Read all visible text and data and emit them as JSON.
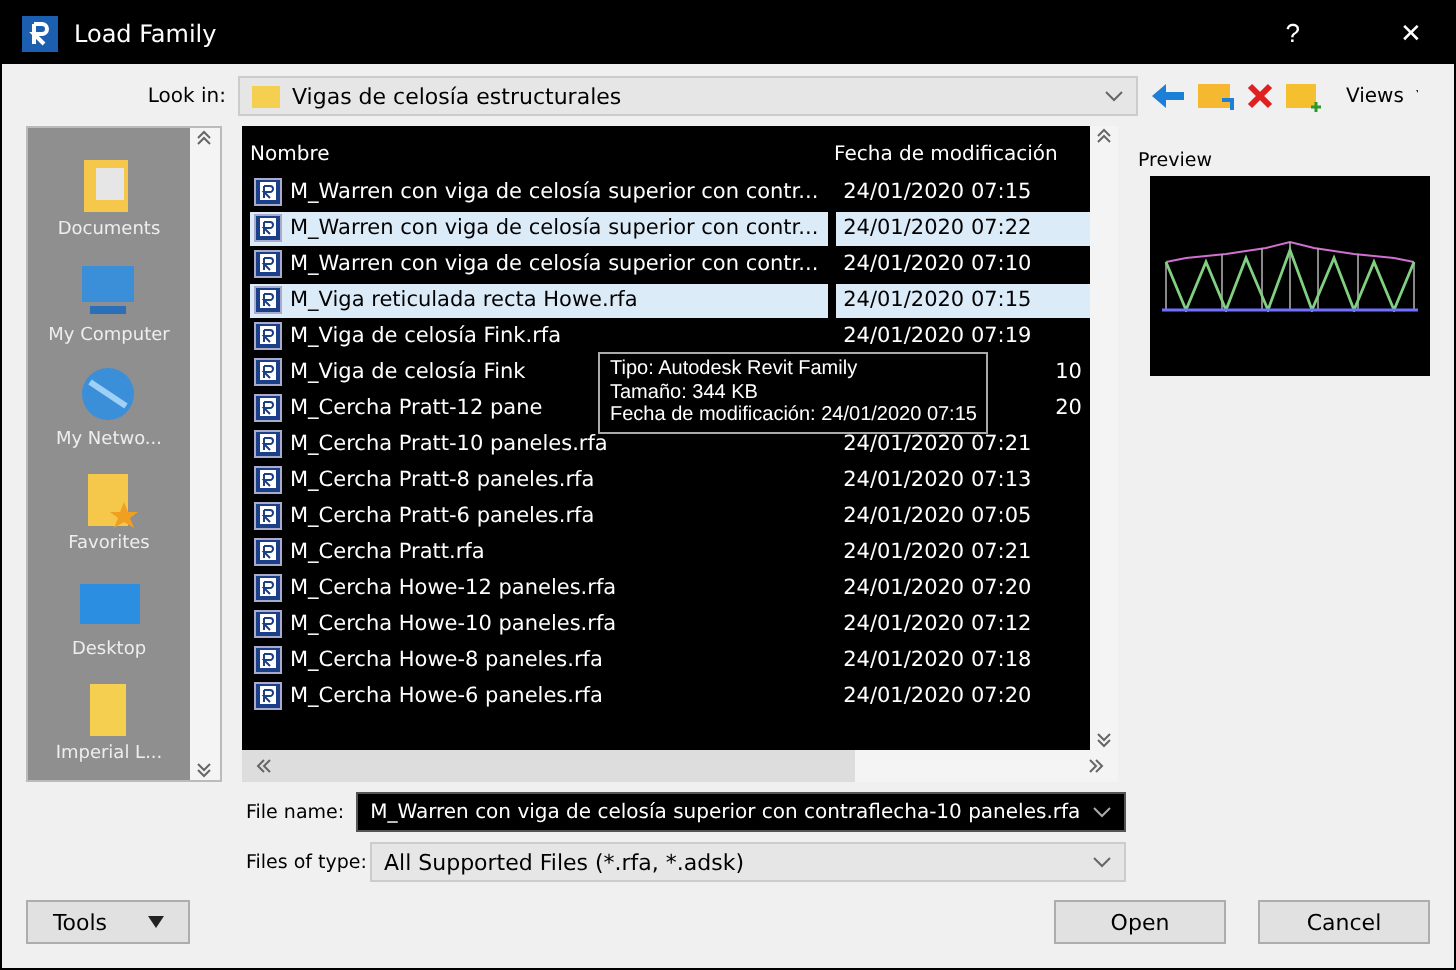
{
  "window": {
    "title": "Load Family",
    "help": "?",
    "close": "✕"
  },
  "look_in": {
    "label": "Look in:",
    "value": "Vigas de celosía estructurales"
  },
  "toolbar": {
    "views": "Views"
  },
  "places": [
    {
      "label": "Documents",
      "kind": "documents"
    },
    {
      "label": "My Computer",
      "kind": "computer"
    },
    {
      "label": "My Netwo...",
      "kind": "network"
    },
    {
      "label": "Favorites",
      "kind": "favorites"
    },
    {
      "label": "Desktop",
      "kind": "desktop"
    },
    {
      "label": "Imperial L...",
      "kind": "folder"
    }
  ],
  "columns": [
    "Nombre",
    "Fecha de modificación"
  ],
  "files": [
    {
      "name": "M_Warren con viga de celosía superior con contr...",
      "date": "24/01/2020 07:15",
      "selected": false,
      "covered": false
    },
    {
      "name": "M_Warren con viga de celosía superior con contr...",
      "date": "24/01/2020 07:22",
      "selected": true,
      "covered": false
    },
    {
      "name": "M_Warren con viga de celosía superior con contr...",
      "date": "24/01/2020 07:10",
      "selected": false,
      "covered": false
    },
    {
      "name": "M_Viga reticulada recta Howe.rfa",
      "date": "24/01/2020 07:15",
      "selected": true,
      "covered": false
    },
    {
      "name": "M_Viga de celosía Fink.rfa",
      "date": "24/01/2020 07:19",
      "selected": false,
      "covered": false
    },
    {
      "name": "M_Viga de celosía Fink",
      "date": "10",
      "selected": false,
      "covered": true
    },
    {
      "name": "M_Cercha Pratt-12 pane",
      "date": "20",
      "selected": false,
      "covered": true
    },
    {
      "name": "M_Cercha Pratt-10 paneles.rfa",
      "date": "24/01/2020 07:21",
      "selected": false,
      "covered": false
    },
    {
      "name": "M_Cercha Pratt-8 paneles.rfa",
      "date": "24/01/2020 07:13",
      "selected": false,
      "covered": false
    },
    {
      "name": "M_Cercha Pratt-6 paneles.rfa",
      "date": "24/01/2020 07:05",
      "selected": false,
      "covered": false
    },
    {
      "name": "M_Cercha Pratt.rfa",
      "date": "24/01/2020 07:21",
      "selected": false,
      "covered": false
    },
    {
      "name": "M_Cercha Howe-12 paneles.rfa",
      "date": "24/01/2020 07:20",
      "selected": false,
      "covered": false
    },
    {
      "name": "M_Cercha Howe-10 paneles.rfa",
      "date": "24/01/2020 07:12",
      "selected": false,
      "covered": false
    },
    {
      "name": "M_Cercha Howe-8 paneles.rfa",
      "date": "24/01/2020 07:18",
      "selected": false,
      "covered": false
    },
    {
      "name": "M_Cercha Howe-6 paneles.rfa",
      "date": "24/01/2020 07:20",
      "selected": false,
      "covered": false
    }
  ],
  "tooltip": [
    "Tipo: Autodesk Revit Family",
    "Tamaño: 344 KB",
    "Fecha de modificación: 24/01/2020 07:15"
  ],
  "preview": {
    "label": "Preview"
  },
  "file_name": {
    "label": "File name:",
    "value": "M_Warren con viga de celosía superior con contraflecha-10 paneles.rfa"
  },
  "file_type": {
    "label": "Files of type:",
    "value": "All Supported Files  (*.rfa, *.adsk)"
  },
  "buttons": {
    "tools": "Tools",
    "open": "Open",
    "cancel": "Cancel"
  }
}
